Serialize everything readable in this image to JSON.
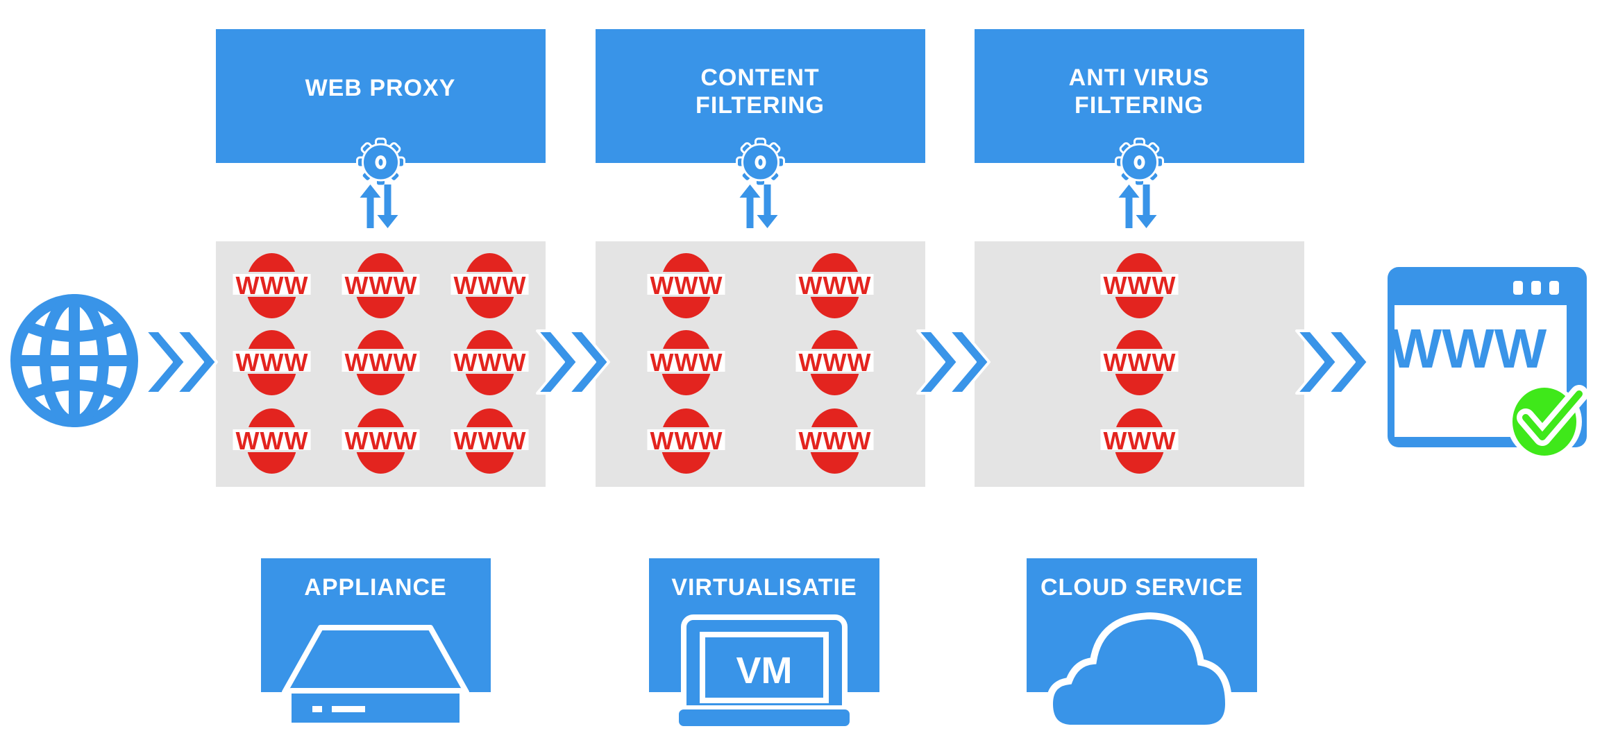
{
  "colors": {
    "blue": "#3994e8",
    "gray": "#e4e4e4",
    "red": "#e3241f",
    "green": "#3fe81a",
    "white": "#ffffff"
  },
  "stages": [
    {
      "lines": [
        "WEB PROXY"
      ],
      "www_columns": 3,
      "www_rows": 3,
      "icon": "gear-icon"
    },
    {
      "lines": [
        "CONTENT",
        "FILTERING"
      ],
      "www_columns": 2,
      "www_rows": 3,
      "icon": "gear-icon"
    },
    {
      "lines": [
        "ANTI VIRUS",
        "FILTERING"
      ],
      "www_columns": 1,
      "www_rows": 3,
      "icon": "gear-icon"
    }
  ],
  "www_label": "WWW",
  "browser": {
    "label": "WWW",
    "icon": "browser-window-icon",
    "badge": "check-icon"
  },
  "source_icon": "globe-icon",
  "deployments": [
    {
      "label": "APPLIANCE",
      "icon": "appliance-icon"
    },
    {
      "label": "VIRTUALISATIE",
      "icon": "laptop-vm-icon",
      "screen_label": "VM"
    },
    {
      "label": "CLOUD SERVICE",
      "icon": "cloud-icon"
    }
  ]
}
